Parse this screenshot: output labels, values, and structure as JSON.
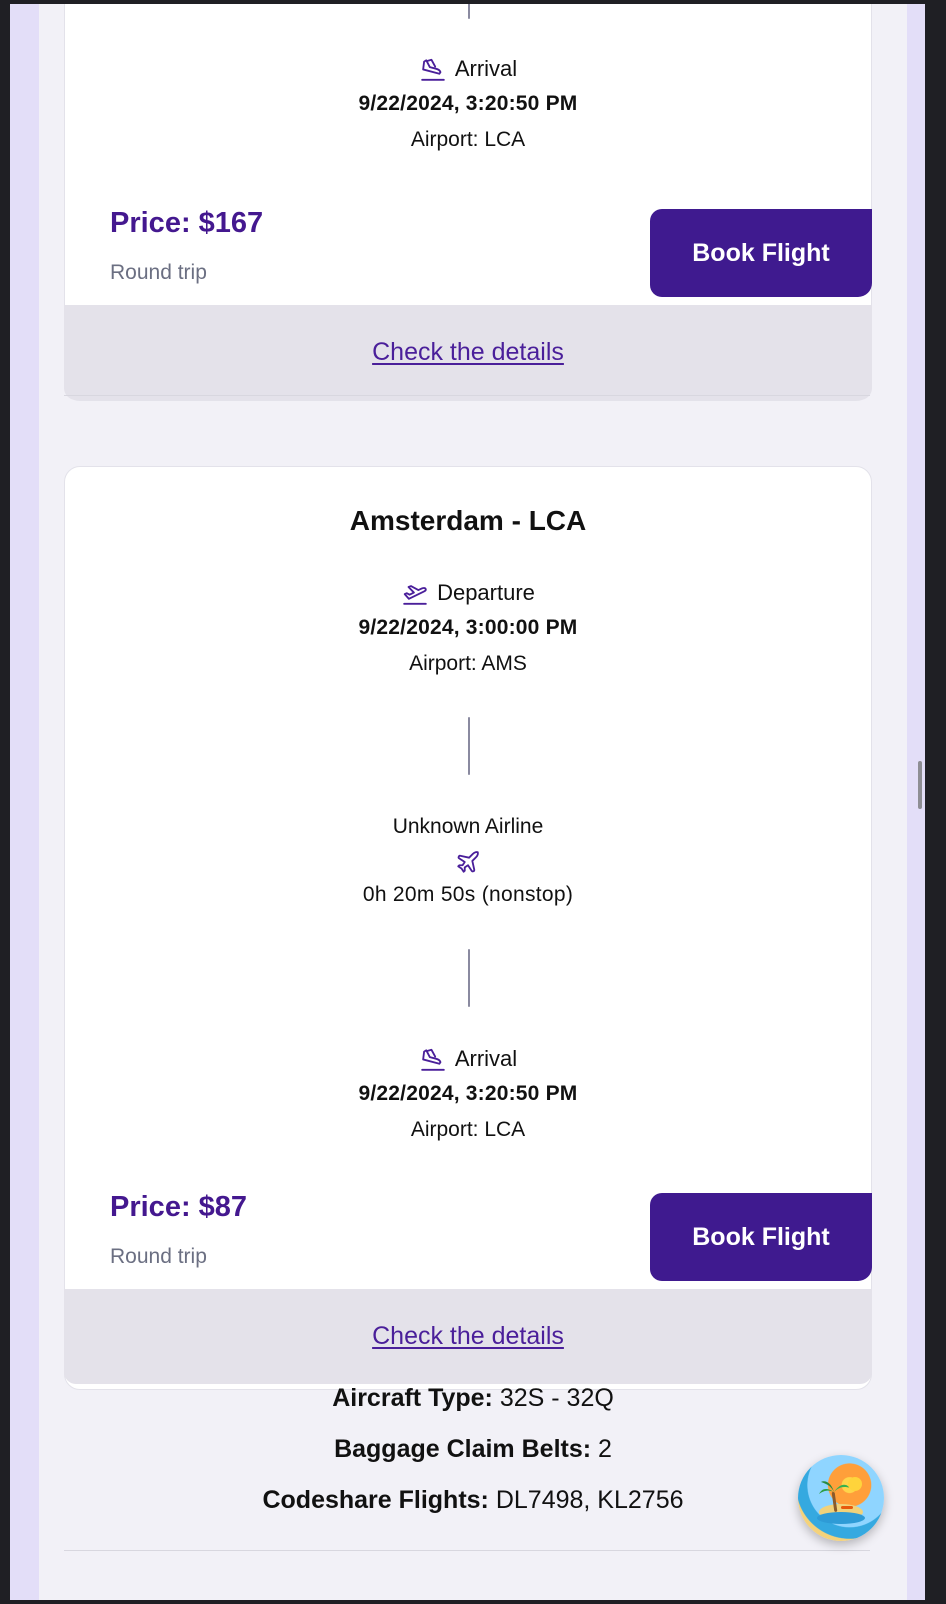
{
  "cards": [
    {
      "arrival": {
        "label": "Arrival",
        "datetime": "9/22/2024, 3:20:50 PM",
        "airport": "Airport: LCA"
      },
      "price": "Price: $167",
      "trip_type": "Round trip",
      "book_label": "Book Flight",
      "details_label": "Check the details"
    },
    {
      "route": "Amsterdam - LCA",
      "departure": {
        "label": "Departure",
        "datetime": "9/22/2024, 3:00:00 PM",
        "airport": "Airport: AMS"
      },
      "airline": "Unknown Airline",
      "duration": "0h 20m 50s (nonstop)",
      "arrival": {
        "label": "Arrival",
        "datetime": "9/22/2024, 3:20:50 PM",
        "airport": "Airport: LCA"
      },
      "price": "Price: $87",
      "trip_type": "Round trip",
      "book_label": "Book Flight",
      "details_label": "Check the details"
    }
  ],
  "flight_details": {
    "aircraft_label": "Aircraft Type:",
    "aircraft_value": "32S - 32Q",
    "baggage_label": "Baggage Claim Belts:",
    "baggage_value": "2",
    "codeshare_label": "Codeshare Flights:",
    "codeshare_value": "DL7498, KL2756"
  },
  "icons": {
    "departure": "plane-takeoff-icon",
    "arrival": "plane-landing-icon",
    "flight": "plane-icon",
    "assistant": "beach-island-icon"
  },
  "colors": {
    "accent": "#44188f",
    "button": "#3f1a8f",
    "background": "#e3def8"
  }
}
